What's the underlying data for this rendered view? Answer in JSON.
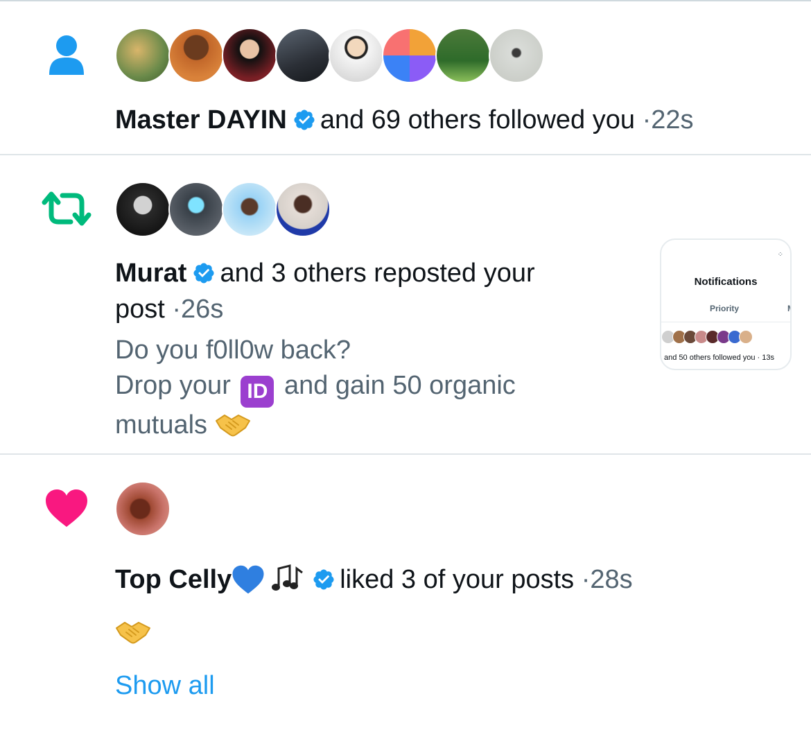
{
  "notifications": [
    {
      "type": "follow",
      "icon": "person-icon",
      "icon_color": "#1d9bf0",
      "name": "Master DAYIN",
      "verified": true,
      "action": "and 69 others followed you",
      "separator": "·",
      "time": "22s",
      "avatar_count": 8
    },
    {
      "type": "repost",
      "icon": "repost-icon",
      "icon_color": "#00ba7c",
      "name": "Murat",
      "verified": true,
      "action_line1": "and 3 others reposted your",
      "action_line2": "post",
      "separator": "·",
      "time": "26s",
      "post_line1": "Do you f0ll0w back?",
      "post_line2_a": "Drop your",
      "post_line2_badge": "ID",
      "post_line2_b": "and gain 50 organic",
      "post_line3": "mutuals",
      "avatar_count": 4,
      "thumbnail": {
        "title": "Notifications",
        "tab": "Priority",
        "tab2": "M",
        "caption": "and 50 others followed you · 13s"
      }
    },
    {
      "type": "like",
      "icon": "heart-icon",
      "icon_color": "#f91880",
      "name": "Top Celly",
      "verified": true,
      "action": "liked 3 of your posts",
      "separator": "·",
      "time": "28s",
      "avatar_count": 1,
      "show_all": "Show all"
    }
  ]
}
